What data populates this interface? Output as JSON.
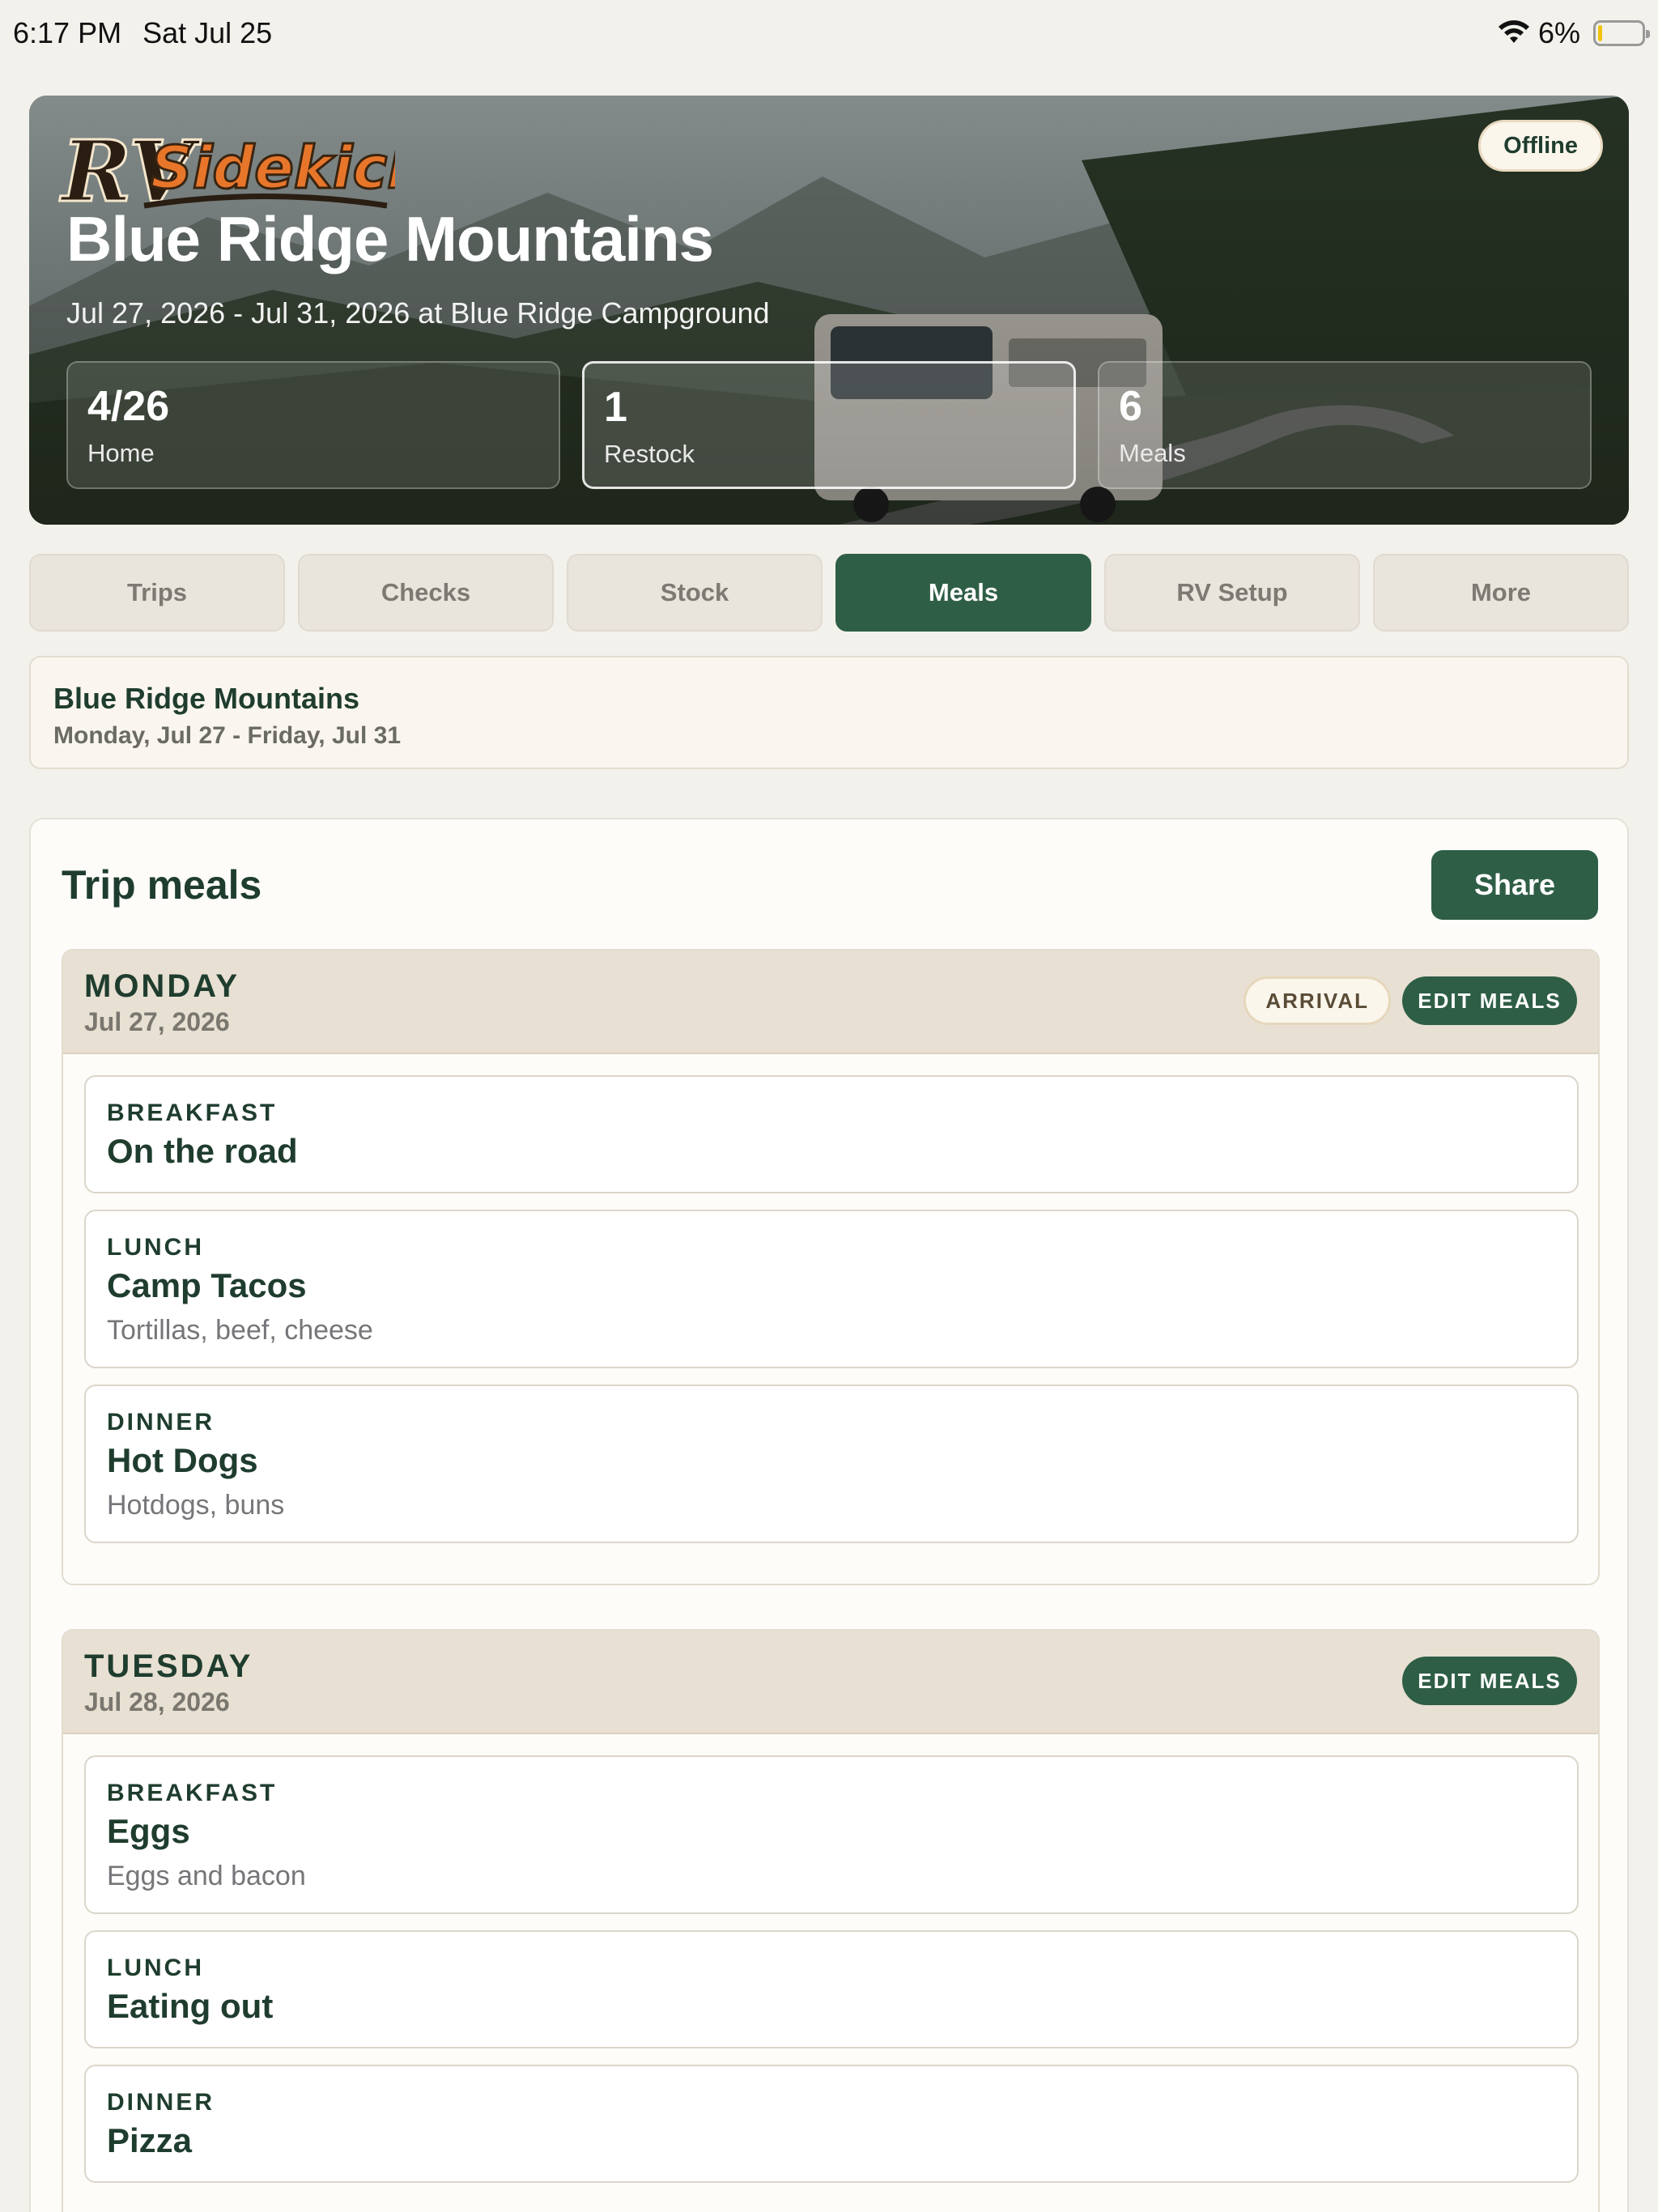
{
  "status_bar": {
    "time": "6:17 PM",
    "date": "Sat Jul 25",
    "battery": "6%",
    "battery_level": 0.06
  },
  "hero": {
    "logo_text": "RVSidekick",
    "offline_label": "Offline",
    "title": "Blue Ridge Mountains",
    "subtitle": "Jul 27, 2026 - Jul 31, 2026 at Blue Ridge Campground",
    "stats": [
      {
        "value": "4/26",
        "label": "Home"
      },
      {
        "value": "1",
        "label": "Restock"
      },
      {
        "value": "6",
        "label": "Meals"
      }
    ]
  },
  "tabs": [
    {
      "label": "Trips"
    },
    {
      "label": "Checks"
    },
    {
      "label": "Stock"
    },
    {
      "label": "Meals",
      "active": true
    },
    {
      "label": "RV Setup"
    },
    {
      "label": "More"
    }
  ],
  "trip_summary": {
    "title": "Blue Ridge Mountains",
    "dates": "Monday, Jul 27 - Friday, Jul 31"
  },
  "meals_panel": {
    "heading": "Trip meals",
    "share_label": "Share",
    "days": [
      {
        "name": "MONDAY",
        "date": "Jul 27, 2026",
        "badge": "ARRIVAL",
        "edit_label": "EDIT MEALS",
        "meals": [
          {
            "type": "BREAKFAST",
            "name": "On the road",
            "items": ""
          },
          {
            "type": "LUNCH",
            "name": "Camp Tacos",
            "items": "Tortillas, beef, cheese"
          },
          {
            "type": "DINNER",
            "name": "Hot Dogs",
            "items": "Hotdogs, buns"
          }
        ]
      },
      {
        "name": "TUESDAY",
        "date": "Jul 28, 2026",
        "badge": "",
        "edit_label": "EDIT MEALS",
        "meals": [
          {
            "type": "BREAKFAST",
            "name": "Eggs",
            "items": "Eggs and bacon"
          },
          {
            "type": "LUNCH",
            "name": "Eating out",
            "items": ""
          },
          {
            "type": "DINNER",
            "name": "Pizza",
            "items": ""
          }
        ]
      }
    ]
  },
  "colors": {
    "accent_green": "#2f5e46",
    "background": "#f3f1ec",
    "day_header": "#e8e0d2",
    "logo_orange": "#e8762a"
  }
}
